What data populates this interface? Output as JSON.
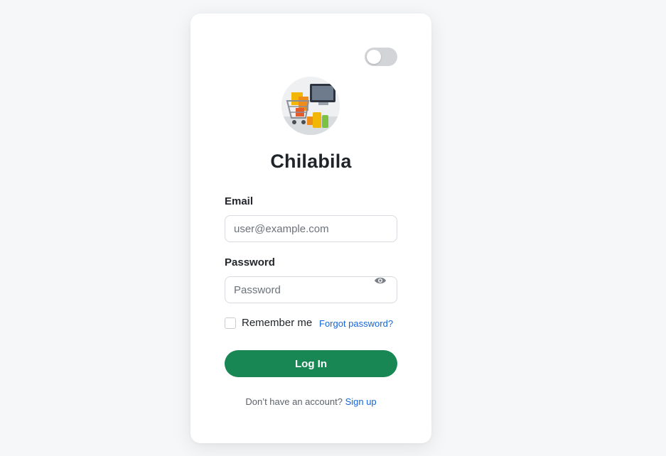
{
  "theme": {
    "accent": "#198754",
    "link": "#1565d8",
    "toggle_off": "#d2d4d7"
  },
  "theme_toggle": {
    "icon": "toggle-switch",
    "state": "off"
  },
  "logo": {
    "icon": "shopping-cart-logo",
    "alt": "Chilabila logo"
  },
  "brand": {
    "name": "Chilabila"
  },
  "email": {
    "label": "Email",
    "placeholder": "user@example.com",
    "value": ""
  },
  "password": {
    "label": "Password",
    "placeholder": "Password",
    "value": "",
    "toggle_icon": "eye-icon"
  },
  "remember": {
    "label": "Remember me",
    "checked": false
  },
  "forgot": {
    "label": "Forgot password?"
  },
  "login": {
    "label": "Log In"
  },
  "signup": {
    "prompt": "Don’t have an account?",
    "link_label": "Sign up"
  }
}
